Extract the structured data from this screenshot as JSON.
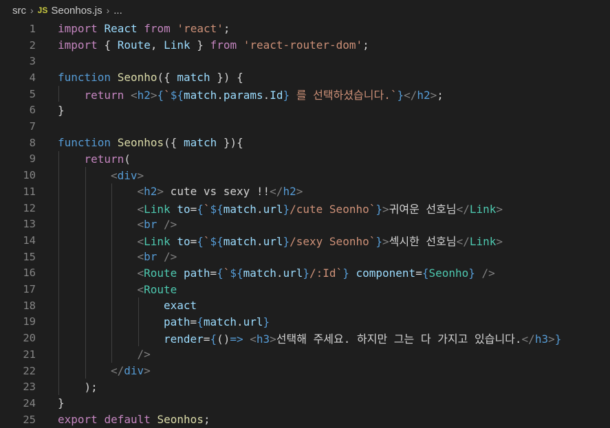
{
  "breadcrumb": {
    "folder": "src",
    "badge": "JS",
    "file": "Seonhos.js",
    "ellipsis": "..."
  },
  "lines": [
    {
      "n": "1",
      "indent": 0,
      "tokens": [
        [
          "kw2",
          "import"
        ],
        [
          "plain",
          " "
        ],
        [
          "var",
          "React"
        ],
        [
          "plain",
          " "
        ],
        [
          "kw2",
          "from"
        ],
        [
          "plain",
          " "
        ],
        [
          "str",
          "'react'"
        ],
        [
          "plain",
          ";"
        ]
      ]
    },
    {
      "n": "2",
      "indent": 0,
      "tokens": [
        [
          "kw2",
          "import"
        ],
        [
          "plain",
          " "
        ],
        [
          "plain",
          "{ "
        ],
        [
          "var",
          "Route"
        ],
        [
          "plain",
          ", "
        ],
        [
          "var",
          "Link"
        ],
        [
          "plain",
          " } "
        ],
        [
          "kw2",
          "from"
        ],
        [
          "plain",
          " "
        ],
        [
          "str",
          "'react-router-dom'"
        ],
        [
          "plain",
          ";"
        ]
      ]
    },
    {
      "n": "3",
      "indent": 0,
      "tokens": []
    },
    {
      "n": "4",
      "indent": 0,
      "tokens": [
        [
          "kw",
          "function"
        ],
        [
          "plain",
          " "
        ],
        [
          "fn",
          "Seonho"
        ],
        [
          "plain",
          "({ "
        ],
        [
          "var",
          "match"
        ],
        [
          "plain",
          " }) {"
        ]
      ]
    },
    {
      "n": "5",
      "indent": 1,
      "tokens": [
        [
          "kw2",
          "return"
        ],
        [
          "plain",
          " "
        ],
        [
          "punc",
          "<"
        ],
        [
          "tag",
          "h2"
        ],
        [
          "punc",
          ">"
        ],
        [
          "kw",
          "{"
        ],
        [
          "str",
          "`"
        ],
        [
          "kw",
          "${"
        ],
        [
          "var",
          "match"
        ],
        [
          "plain",
          "."
        ],
        [
          "var",
          "params"
        ],
        [
          "plain",
          "."
        ],
        [
          "var",
          "Id"
        ],
        [
          "kw",
          "}"
        ],
        [
          "str",
          " 를 선택하셨습니다.`"
        ],
        [
          "kw",
          "}"
        ],
        [
          "punc",
          "</"
        ],
        [
          "tag",
          "h2"
        ],
        [
          "punc",
          ">"
        ],
        [
          "plain",
          ";"
        ]
      ]
    },
    {
      "n": "6",
      "indent": 0,
      "tokens": [
        [
          "plain",
          "}"
        ]
      ]
    },
    {
      "n": "7",
      "indent": 0,
      "tokens": []
    },
    {
      "n": "8",
      "indent": 0,
      "tokens": [
        [
          "kw",
          "function"
        ],
        [
          "plain",
          " "
        ],
        [
          "fn",
          "Seonhos"
        ],
        [
          "plain",
          "({ "
        ],
        [
          "var",
          "match"
        ],
        [
          "plain",
          " }){"
        ]
      ]
    },
    {
      "n": "9",
      "indent": 1,
      "tokens": [
        [
          "kw2",
          "return"
        ],
        [
          "plain",
          "("
        ]
      ]
    },
    {
      "n": "10",
      "indent": 2,
      "tokens": [
        [
          "punc",
          "<"
        ],
        [
          "tag",
          "div"
        ],
        [
          "punc",
          ">"
        ]
      ]
    },
    {
      "n": "11",
      "indent": 3,
      "tokens": [
        [
          "punc",
          "<"
        ],
        [
          "tag",
          "h2"
        ],
        [
          "punc",
          ">"
        ],
        [
          "plain",
          " cute vs sexy !!"
        ],
        [
          "punc",
          "</"
        ],
        [
          "tag",
          "h2"
        ],
        [
          "punc",
          ">"
        ]
      ]
    },
    {
      "n": "12",
      "indent": 3,
      "tokens": [
        [
          "punc",
          "<"
        ],
        [
          "comp",
          "Link"
        ],
        [
          "plain",
          " "
        ],
        [
          "var",
          "to"
        ],
        [
          "plain",
          "="
        ],
        [
          "kw",
          "{"
        ],
        [
          "str",
          "`"
        ],
        [
          "kw",
          "${"
        ],
        [
          "var",
          "match"
        ],
        [
          "plain",
          "."
        ],
        [
          "var",
          "url"
        ],
        [
          "kw",
          "}"
        ],
        [
          "str",
          "/cute Seonho`"
        ],
        [
          "kw",
          "}"
        ],
        [
          "punc",
          ">"
        ],
        [
          "plain",
          "귀여운 선호님"
        ],
        [
          "punc",
          "</"
        ],
        [
          "comp",
          "Link"
        ],
        [
          "punc",
          ">"
        ]
      ]
    },
    {
      "n": "13",
      "indent": 3,
      "tokens": [
        [
          "punc",
          "<"
        ],
        [
          "tag",
          "br"
        ],
        [
          "plain",
          " "
        ],
        [
          "punc",
          "/>"
        ]
      ]
    },
    {
      "n": "14",
      "indent": 3,
      "tokens": [
        [
          "punc",
          "<"
        ],
        [
          "comp",
          "Link"
        ],
        [
          "plain",
          " "
        ],
        [
          "var",
          "to"
        ],
        [
          "plain",
          "="
        ],
        [
          "kw",
          "{"
        ],
        [
          "str",
          "`"
        ],
        [
          "kw",
          "${"
        ],
        [
          "var",
          "match"
        ],
        [
          "plain",
          "."
        ],
        [
          "var",
          "url"
        ],
        [
          "kw",
          "}"
        ],
        [
          "str",
          "/sexy Seonho`"
        ],
        [
          "kw",
          "}"
        ],
        [
          "punc",
          ">"
        ],
        [
          "plain",
          "섹시한 선호님"
        ],
        [
          "punc",
          "</"
        ],
        [
          "comp",
          "Link"
        ],
        [
          "punc",
          ">"
        ]
      ]
    },
    {
      "n": "15",
      "indent": 3,
      "tokens": [
        [
          "punc",
          "<"
        ],
        [
          "tag",
          "br"
        ],
        [
          "plain",
          " "
        ],
        [
          "punc",
          "/>"
        ]
      ]
    },
    {
      "n": "16",
      "indent": 3,
      "tokens": [
        [
          "punc",
          "<"
        ],
        [
          "comp",
          "Route"
        ],
        [
          "plain",
          " "
        ],
        [
          "var",
          "path"
        ],
        [
          "plain",
          "="
        ],
        [
          "kw",
          "{"
        ],
        [
          "str",
          "`"
        ],
        [
          "kw",
          "${"
        ],
        [
          "var",
          "match"
        ],
        [
          "plain",
          "."
        ],
        [
          "var",
          "url"
        ],
        [
          "kw",
          "}"
        ],
        [
          "str",
          "/:Id`"
        ],
        [
          "kw",
          "}"
        ],
        [
          "plain",
          " "
        ],
        [
          "var",
          "component"
        ],
        [
          "plain",
          "="
        ],
        [
          "kw",
          "{"
        ],
        [
          "comp",
          "Seonho"
        ],
        [
          "kw",
          "}"
        ],
        [
          "plain",
          " "
        ],
        [
          "punc",
          "/>"
        ]
      ]
    },
    {
      "n": "17",
      "indent": 3,
      "tokens": [
        [
          "punc",
          "<"
        ],
        [
          "comp",
          "Route"
        ]
      ]
    },
    {
      "n": "18",
      "indent": 4,
      "tokens": [
        [
          "var",
          "exact"
        ]
      ]
    },
    {
      "n": "19",
      "indent": 4,
      "tokens": [
        [
          "var",
          "path"
        ],
        [
          "plain",
          "="
        ],
        [
          "kw",
          "{"
        ],
        [
          "var",
          "match"
        ],
        [
          "plain",
          "."
        ],
        [
          "var",
          "url"
        ],
        [
          "kw",
          "}"
        ]
      ]
    },
    {
      "n": "20",
      "indent": 4,
      "tokens": [
        [
          "var",
          "render"
        ],
        [
          "plain",
          "="
        ],
        [
          "kw",
          "{"
        ],
        [
          "plain",
          "()"
        ],
        [
          "kw",
          "=>"
        ],
        [
          "plain",
          " "
        ],
        [
          "punc",
          "<"
        ],
        [
          "tag",
          "h3"
        ],
        [
          "punc",
          ">"
        ],
        [
          "plain",
          "선택해 주세요. 하지만 그는 다 가지고 있습니다."
        ],
        [
          "punc",
          "</"
        ],
        [
          "tag",
          "h3"
        ],
        [
          "punc",
          ">"
        ],
        [
          "kw",
          "}"
        ]
      ]
    },
    {
      "n": "21",
      "indent": 3,
      "tokens": [
        [
          "punc",
          "/>"
        ]
      ]
    },
    {
      "n": "22",
      "indent": 2,
      "tokens": [
        [
          "punc",
          "</"
        ],
        [
          "tag",
          "div"
        ],
        [
          "punc",
          ">"
        ]
      ]
    },
    {
      "n": "23",
      "indent": 1,
      "tokens": [
        [
          "plain",
          ");"
        ]
      ]
    },
    {
      "n": "24",
      "indent": 0,
      "tokens": [
        [
          "plain",
          "}"
        ]
      ]
    },
    {
      "n": "25",
      "indent": 0,
      "tokens": [
        [
          "kw2",
          "export"
        ],
        [
          "plain",
          " "
        ],
        [
          "kw2",
          "default"
        ],
        [
          "plain",
          " "
        ],
        [
          "fn",
          "Seonhos"
        ],
        [
          "plain",
          ";"
        ]
      ]
    }
  ]
}
